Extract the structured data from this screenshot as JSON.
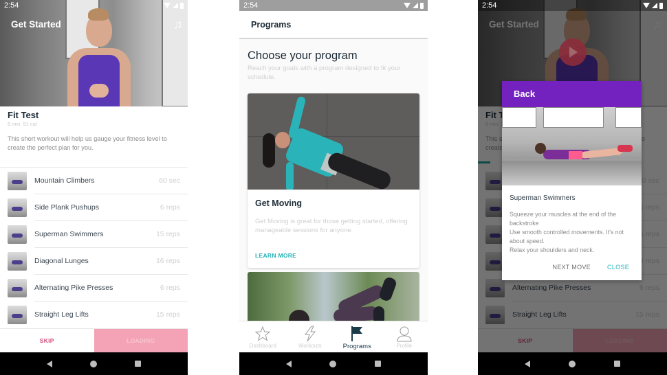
{
  "status_bar": {
    "time": "2:54"
  },
  "fit_test_screen": {
    "header_title": "Get Started",
    "music_icon": "music-note-icon",
    "title": "Fit Test",
    "meta": "8 min, 51 cal",
    "description": "This short workout will help us gauge your fitness level to create the perfect plan for you.",
    "exercises": [
      {
        "name": "Mountain Climbers",
        "value": "60 sec"
      },
      {
        "name": "Side Plank Pushups",
        "value": "6 reps"
      },
      {
        "name": "Superman Swimmers",
        "value": "15 reps"
      },
      {
        "name": "Diagonal Lunges",
        "value": "16 reps"
      },
      {
        "name": "Alternating Pike Presses",
        "value": "6 reps"
      },
      {
        "name": "Straight Leg Lifts",
        "value": "15 reps"
      }
    ],
    "skip_label": "SKIP",
    "loading_label": "LOADING"
  },
  "programs_screen": {
    "header_title": "Programs",
    "heading": "Choose your program",
    "subheading": "Reach your goals with a program designed to fit your schedule.",
    "card": {
      "title": "Get Moving",
      "description": "Get Moving is great for those getting started, offering manageable sessions for anyone.",
      "link": "LEARN MORE"
    },
    "tabs": [
      {
        "label": "Dashboard",
        "icon": "star-icon",
        "active": false
      },
      {
        "label": "Workouts",
        "icon": "lightning-icon",
        "active": false
      },
      {
        "label": "Programs",
        "icon": "flag-icon",
        "active": true
      },
      {
        "label": "Profile",
        "icon": "person-icon",
        "active": false
      }
    ]
  },
  "exercise_dialog_screen": {
    "background_exercises": [
      {
        "name": "Alternating Pike Presses",
        "value": "6 reps"
      },
      {
        "name": "Straight Leg Lifts",
        "value": "15 reps"
      }
    ],
    "dialog": {
      "back_label": "Back",
      "title": "Superman Swimmers",
      "tips": [
        "Squeeze your muscles  at the end of the backstroke",
        "Use smooth controlled movements. It's not about speed.",
        "Relax your shoulders and neck."
      ],
      "next_label": "NEXT MOVE",
      "close_label": "CLOSE"
    }
  },
  "colors": {
    "accent_teal": "#23b2b5",
    "dialog_purple": "#7422bf",
    "skip_pink": "#d24a74",
    "loading_pink": "#f4a3b6",
    "heading_navy": "#1b2a35"
  }
}
